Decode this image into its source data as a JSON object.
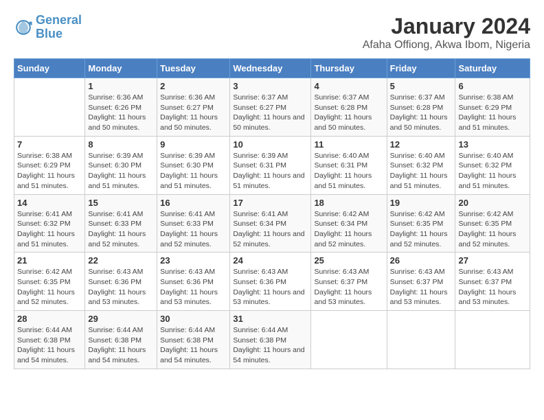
{
  "logo": {
    "line1": "General",
    "line2": "Blue"
  },
  "title": "January 2024",
  "subtitle": "Afaha Offiong, Akwa Ibom, Nigeria",
  "headers": [
    "Sunday",
    "Monday",
    "Tuesday",
    "Wednesday",
    "Thursday",
    "Friday",
    "Saturday"
  ],
  "weeks": [
    [
      {
        "day": "",
        "sunrise": "",
        "sunset": "",
        "daylight": ""
      },
      {
        "day": "1",
        "sunrise": "Sunrise: 6:36 AM",
        "sunset": "Sunset: 6:26 PM",
        "daylight": "Daylight: 11 hours and 50 minutes."
      },
      {
        "day": "2",
        "sunrise": "Sunrise: 6:36 AM",
        "sunset": "Sunset: 6:27 PM",
        "daylight": "Daylight: 11 hours and 50 minutes."
      },
      {
        "day": "3",
        "sunrise": "Sunrise: 6:37 AM",
        "sunset": "Sunset: 6:27 PM",
        "daylight": "Daylight: 11 hours and 50 minutes."
      },
      {
        "day": "4",
        "sunrise": "Sunrise: 6:37 AM",
        "sunset": "Sunset: 6:28 PM",
        "daylight": "Daylight: 11 hours and 50 minutes."
      },
      {
        "day": "5",
        "sunrise": "Sunrise: 6:37 AM",
        "sunset": "Sunset: 6:28 PM",
        "daylight": "Daylight: 11 hours and 50 minutes."
      },
      {
        "day": "6",
        "sunrise": "Sunrise: 6:38 AM",
        "sunset": "Sunset: 6:29 PM",
        "daylight": "Daylight: 11 hours and 51 minutes."
      }
    ],
    [
      {
        "day": "7",
        "sunrise": "Sunrise: 6:38 AM",
        "sunset": "Sunset: 6:29 PM",
        "daylight": "Daylight: 11 hours and 51 minutes."
      },
      {
        "day": "8",
        "sunrise": "Sunrise: 6:39 AM",
        "sunset": "Sunset: 6:30 PM",
        "daylight": "Daylight: 11 hours and 51 minutes."
      },
      {
        "day": "9",
        "sunrise": "Sunrise: 6:39 AM",
        "sunset": "Sunset: 6:30 PM",
        "daylight": "Daylight: 11 hours and 51 minutes."
      },
      {
        "day": "10",
        "sunrise": "Sunrise: 6:39 AM",
        "sunset": "Sunset: 6:31 PM",
        "daylight": "Daylight: 11 hours and 51 minutes."
      },
      {
        "day": "11",
        "sunrise": "Sunrise: 6:40 AM",
        "sunset": "Sunset: 6:31 PM",
        "daylight": "Daylight: 11 hours and 51 minutes."
      },
      {
        "day": "12",
        "sunrise": "Sunrise: 6:40 AM",
        "sunset": "Sunset: 6:32 PM",
        "daylight": "Daylight: 11 hours and 51 minutes."
      },
      {
        "day": "13",
        "sunrise": "Sunrise: 6:40 AM",
        "sunset": "Sunset: 6:32 PM",
        "daylight": "Daylight: 11 hours and 51 minutes."
      }
    ],
    [
      {
        "day": "14",
        "sunrise": "Sunrise: 6:41 AM",
        "sunset": "Sunset: 6:32 PM",
        "daylight": "Daylight: 11 hours and 51 minutes."
      },
      {
        "day": "15",
        "sunrise": "Sunrise: 6:41 AM",
        "sunset": "Sunset: 6:33 PM",
        "daylight": "Daylight: 11 hours and 52 minutes."
      },
      {
        "day": "16",
        "sunrise": "Sunrise: 6:41 AM",
        "sunset": "Sunset: 6:33 PM",
        "daylight": "Daylight: 11 hours and 52 minutes."
      },
      {
        "day": "17",
        "sunrise": "Sunrise: 6:41 AM",
        "sunset": "Sunset: 6:34 PM",
        "daylight": "Daylight: 11 hours and 52 minutes."
      },
      {
        "day": "18",
        "sunrise": "Sunrise: 6:42 AM",
        "sunset": "Sunset: 6:34 PM",
        "daylight": "Daylight: 11 hours and 52 minutes."
      },
      {
        "day": "19",
        "sunrise": "Sunrise: 6:42 AM",
        "sunset": "Sunset: 6:35 PM",
        "daylight": "Daylight: 11 hours and 52 minutes."
      },
      {
        "day": "20",
        "sunrise": "Sunrise: 6:42 AM",
        "sunset": "Sunset: 6:35 PM",
        "daylight": "Daylight: 11 hours and 52 minutes."
      }
    ],
    [
      {
        "day": "21",
        "sunrise": "Sunrise: 6:42 AM",
        "sunset": "Sunset: 6:35 PM",
        "daylight": "Daylight: 11 hours and 52 minutes."
      },
      {
        "day": "22",
        "sunrise": "Sunrise: 6:43 AM",
        "sunset": "Sunset: 6:36 PM",
        "daylight": "Daylight: 11 hours and 53 minutes."
      },
      {
        "day": "23",
        "sunrise": "Sunrise: 6:43 AM",
        "sunset": "Sunset: 6:36 PM",
        "daylight": "Daylight: 11 hours and 53 minutes."
      },
      {
        "day": "24",
        "sunrise": "Sunrise: 6:43 AM",
        "sunset": "Sunset: 6:36 PM",
        "daylight": "Daylight: 11 hours and 53 minutes."
      },
      {
        "day": "25",
        "sunrise": "Sunrise: 6:43 AM",
        "sunset": "Sunset: 6:37 PM",
        "daylight": "Daylight: 11 hours and 53 minutes."
      },
      {
        "day": "26",
        "sunrise": "Sunrise: 6:43 AM",
        "sunset": "Sunset: 6:37 PM",
        "daylight": "Daylight: 11 hours and 53 minutes."
      },
      {
        "day": "27",
        "sunrise": "Sunrise: 6:43 AM",
        "sunset": "Sunset: 6:37 PM",
        "daylight": "Daylight: 11 hours and 53 minutes."
      }
    ],
    [
      {
        "day": "28",
        "sunrise": "Sunrise: 6:44 AM",
        "sunset": "Sunset: 6:38 PM",
        "daylight": "Daylight: 11 hours and 54 minutes."
      },
      {
        "day": "29",
        "sunrise": "Sunrise: 6:44 AM",
        "sunset": "Sunset: 6:38 PM",
        "daylight": "Daylight: 11 hours and 54 minutes."
      },
      {
        "day": "30",
        "sunrise": "Sunrise: 6:44 AM",
        "sunset": "Sunset: 6:38 PM",
        "daylight": "Daylight: 11 hours and 54 minutes."
      },
      {
        "day": "31",
        "sunrise": "Sunrise: 6:44 AM",
        "sunset": "Sunset: 6:38 PM",
        "daylight": "Daylight: 11 hours and 54 minutes."
      },
      {
        "day": "",
        "sunrise": "",
        "sunset": "",
        "daylight": ""
      },
      {
        "day": "",
        "sunrise": "",
        "sunset": "",
        "daylight": ""
      },
      {
        "day": "",
        "sunrise": "",
        "sunset": "",
        "daylight": ""
      }
    ]
  ]
}
